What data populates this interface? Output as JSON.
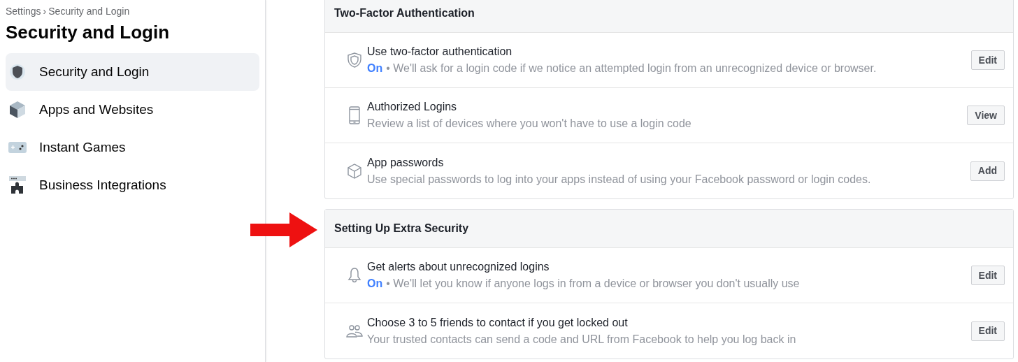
{
  "breadcrumb": {
    "items": [
      "Settings",
      "Security and Login"
    ],
    "separator": "›"
  },
  "page_title": "Security and Login",
  "sidebar": {
    "items": [
      {
        "label": "Security and Login",
        "kind": "shield",
        "selected": true
      },
      {
        "label": "Apps and Websites",
        "kind": "cube",
        "selected": false
      },
      {
        "label": "Instant Games",
        "kind": "gamepad",
        "selected": false
      },
      {
        "label": "Business Integrations",
        "kind": "puzzle",
        "selected": false
      }
    ]
  },
  "sections": [
    {
      "title": "Two-Factor Authentication",
      "highlighted": false,
      "rows": [
        {
          "kind": "shield",
          "title": "Use two-factor authentication",
          "status": "On",
          "description": "• We'll ask for a login code if we notice an attempted login from an unrecognized device or browser.",
          "button": "Edit"
        },
        {
          "kind": "phone",
          "title": "Authorized Logins",
          "description": "Review a list of devices where you won't have to use a login code",
          "button": "View"
        },
        {
          "kind": "cube",
          "title": "App passwords",
          "description": "Use special passwords to log into your apps instead of using your Facebook password or login codes.",
          "button": "Add"
        }
      ]
    },
    {
      "title": "Setting Up Extra Security",
      "highlighted": true,
      "rows": [
        {
          "kind": "bell",
          "title": "Get alerts about unrecognized logins",
          "status": "On",
          "description": "• We'll let you know if anyone logs in from a device or browser you don't usually use",
          "button": "Edit"
        },
        {
          "kind": "people",
          "title": "Choose 3 to 5 friends to contact if you get locked out",
          "description": "Your trusted contacts can send a code and URL from Facebook to help you log back in",
          "button": "Edit"
        }
      ]
    }
  ]
}
